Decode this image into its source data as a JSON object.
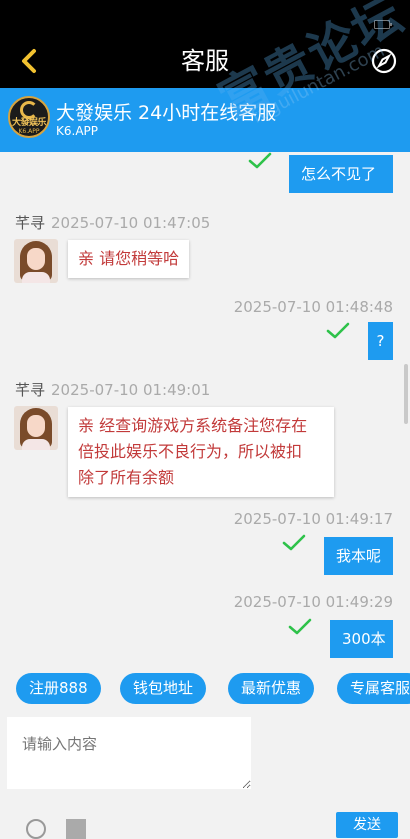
{
  "nav": {
    "title": "客服"
  },
  "header": {
    "title": "大發娱乐 24小时在线客服",
    "subtitle": "K6.APP",
    "logo_text": "大發娱乐",
    "logo_sub": "K6.APP"
  },
  "messages": [
    {
      "type": "out",
      "text": "怎么不见了"
    },
    {
      "type": "in",
      "sender": "芊寻",
      "time": "2025-07-10 01:47:05",
      "text": "亲 请您稍等哈"
    },
    {
      "type": "out",
      "time": "2025-07-10 01:48:48",
      "text": "?"
    },
    {
      "type": "in",
      "sender": "芊寻",
      "time": "2025-07-10 01:49:01",
      "lines": [
        "亲 经查询游戏方系统备注您存在",
        "倍投此娱乐不良行为，所以被扣",
        "除了所有余额"
      ]
    },
    {
      "type": "out",
      "time": "2025-07-10 01:49:17",
      "text": "我本呢"
    },
    {
      "type": "out",
      "time": "2025-07-10 01:49:29",
      "text": "300本"
    }
  ],
  "quick_actions": [
    "注册888",
    "钱包地址",
    "最新优惠",
    "专属客服"
  ],
  "input": {
    "placeholder": "请输入内容"
  },
  "send": {
    "label": "发送"
  },
  "watermark": {
    "big": "富贵论坛",
    "small": "fuguiluntan.com"
  },
  "colors": {
    "accent": "#1e9bf0",
    "check": "#2ec24a",
    "agent_text": "#c23a3a"
  }
}
